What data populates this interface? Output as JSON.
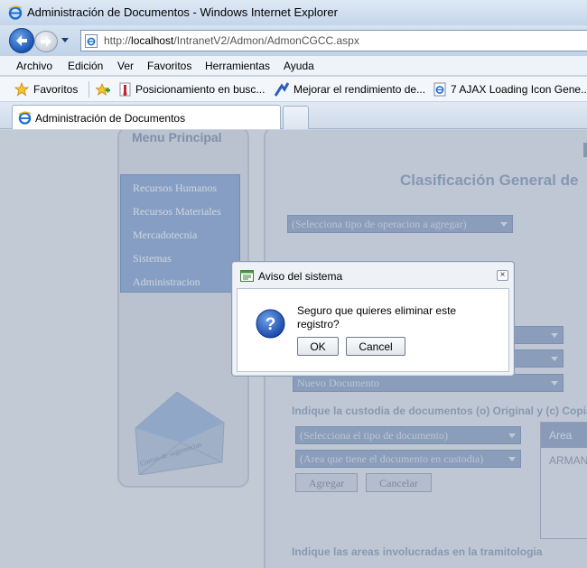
{
  "window": {
    "title": "Administración de Documentos - Windows Internet Explorer"
  },
  "address_bar": {
    "url_prefix": "http://",
    "url_host": "localhost",
    "url_path": "/IntranetV2/Admon/AdmonCGCC.aspx"
  },
  "menu": {
    "items": [
      "Archivo",
      "Edición",
      "Ver",
      "Favoritos",
      "Herramientas",
      "Ayuda"
    ]
  },
  "favorites": {
    "label": "Favoritos",
    "links": [
      "Posicionamiento en busc...",
      "Mejorar el rendimiento de...",
      "7 AJAX Loading Icon Gene..."
    ]
  },
  "tab": {
    "label": "Administración de Documentos"
  },
  "sidebar": {
    "title": "Menu Principal",
    "items": [
      "Recursos Humanos",
      "Recursos Materiales",
      "Mercadotecnia",
      "Sistemas",
      "Administracion"
    ],
    "suggestions_label": "Correo de sugerencias"
  },
  "main": {
    "heading": "Clasificación General de",
    "operation_select": "(Selecciona tipo de operacion a agregar)",
    "document_select": "Nuevo Documento",
    "custody_label": "Indique la custodia de documentos (o) Original y (c) Copia",
    "doc_type_select": "(Selecciona el tipo de documento)",
    "area_select": "(Area que tiene el documento en custodia)",
    "add_button": "Agregar",
    "cancel_button": "Cancelar",
    "grid_header": "Area",
    "grid_cell": "ARMAN",
    "areas_label": "Indique las areas involucradas en la tramitologia"
  },
  "dialog": {
    "title": "Aviso del sistema",
    "message": "Seguro que quieres eliminar este registro?",
    "ok_label": "OK",
    "cancel_label": "Cancel",
    "close_glyph": "×"
  },
  "colors": {
    "menu_box": "#8eabd8",
    "heading": "#8aa0bd",
    "select_fill": "#94a9c9"
  }
}
